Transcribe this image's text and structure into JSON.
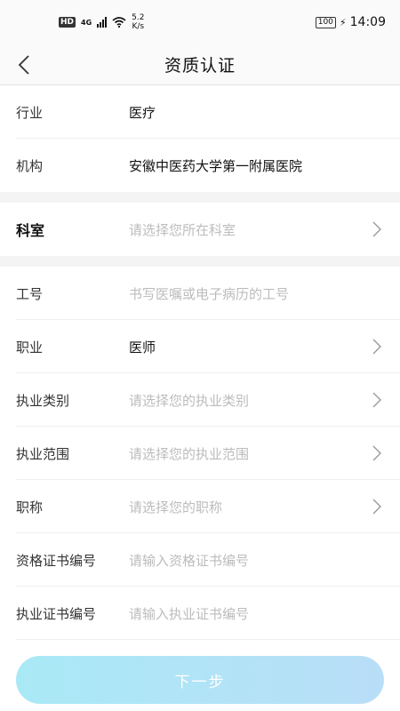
{
  "status_bar": {
    "hd": "HD",
    "network": "4G",
    "speed_value": "5.2",
    "speed_unit": "K/s",
    "battery": "100",
    "time": "14:09"
  },
  "header": {
    "title": "资质认证"
  },
  "section1": {
    "rows": [
      {
        "label": "行业",
        "value": "医疗"
      },
      {
        "label": "机构",
        "value": "安徽中医药大学第一附属医院"
      }
    ]
  },
  "section2": {
    "department": {
      "label": "科室",
      "placeholder": "请选择您所在科室"
    }
  },
  "section3": {
    "rows": [
      {
        "label": "工号",
        "placeholder": "书写医嘱或电子病历的工号"
      },
      {
        "label": "职业",
        "value": "医师"
      },
      {
        "label": "执业类别",
        "placeholder": "请选择您的执业类别"
      },
      {
        "label": "执业范围",
        "placeholder": "请选择您的执业范围"
      },
      {
        "label": "职称",
        "placeholder": "请选择您的职称"
      },
      {
        "label": "资格证书编号",
        "placeholder": "请输入资格证书编号"
      },
      {
        "label": "执业证书编号",
        "placeholder": "请输入执业证书编号"
      }
    ]
  },
  "footer": {
    "next_label": "下一步"
  }
}
